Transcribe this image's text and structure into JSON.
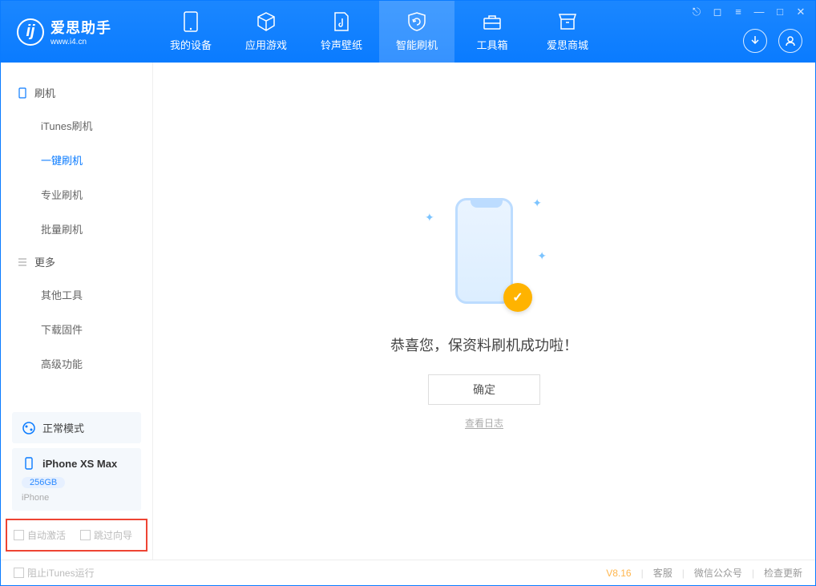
{
  "app": {
    "name": "爱思助手",
    "url": "www.i4.cn"
  },
  "tabs": [
    {
      "label": "我的设备"
    },
    {
      "label": "应用游戏"
    },
    {
      "label": "铃声壁纸"
    },
    {
      "label": "智能刷机"
    },
    {
      "label": "工具箱"
    },
    {
      "label": "爱思商城"
    }
  ],
  "sidebar": {
    "section1": {
      "title": "刷机",
      "items": [
        "iTunes刷机",
        "一键刷机",
        "专业刷机",
        "批量刷机"
      ]
    },
    "section2": {
      "title": "更多",
      "items": [
        "其他工具",
        "下载固件",
        "高级功能"
      ]
    },
    "mode": "正常模式",
    "device": {
      "name": "iPhone XS Max",
      "capacity": "256GB",
      "type": "iPhone"
    },
    "options": {
      "auto_activate": "自动激活",
      "skip_guide": "跳过向导"
    }
  },
  "main": {
    "message": "恭喜您，保资料刷机成功啦！",
    "ok": "确定",
    "view_log": "查看日志"
  },
  "footer": {
    "block_itunes": "阻止iTunes运行",
    "version": "V8.16",
    "links": [
      "客服",
      "微信公众号",
      "检查更新"
    ]
  }
}
